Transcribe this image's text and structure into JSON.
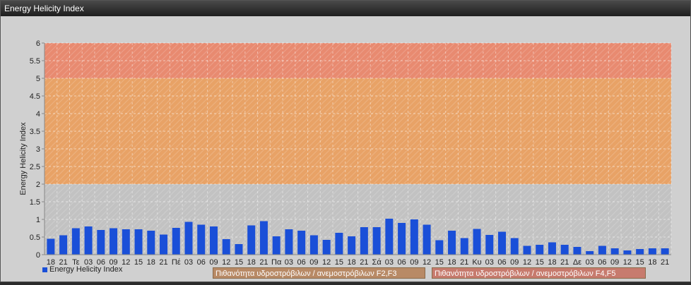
{
  "window": {
    "title": "Energy Helicity Index"
  },
  "legend": {
    "series_label": "Energy Helicity Index",
    "series_color": "#1a4fd8"
  },
  "zones": [
    {
      "label": "Πιθανότητα υδροστρόβιλων / ανεμοστρόβιλων F2,F3",
      "from": 2,
      "to": 5,
      "color": "#e8a266"
    },
    {
      "label": "Πιθανότητα υδροστρόβιλων / ανεμοστρόβιλων F4,F5",
      "from": 5,
      "to": 6,
      "color": "#e88a70"
    }
  ],
  "chart_data": {
    "type": "bar",
    "ylabel": "Energy Helicity Index",
    "ylim": [
      0,
      6
    ],
    "yticks": [
      "0",
      "0.5",
      "1",
      "1.5",
      "2",
      "2.5",
      "3",
      "3.5",
      "4",
      "4.5",
      "5",
      "5.5",
      "6"
    ],
    "grid": true,
    "categories": [
      "18",
      "21",
      "Τε",
      "03",
      "06",
      "09",
      "12",
      "15",
      "18",
      "21",
      "Πέ",
      "03",
      "06",
      "09",
      "12",
      "15",
      "18",
      "21",
      "Πα",
      "03",
      "06",
      "09",
      "12",
      "15",
      "18",
      "21",
      "Σά",
      "03",
      "06",
      "09",
      "12",
      "15",
      "18",
      "21",
      "Κυ",
      "03",
      "06",
      "09",
      "12",
      "15",
      "18",
      "21",
      "Δε",
      "03",
      "06",
      "09",
      "12",
      "15",
      "18",
      "21"
    ],
    "series": [
      {
        "name": "Energy Helicity Index",
        "values": [
          0.45,
          0.55,
          0.75,
          0.8,
          0.7,
          0.75,
          0.72,
          0.72,
          0.68,
          0.57,
          0.76,
          0.93,
          0.85,
          0.8,
          0.44,
          0.3,
          0.83,
          0.95,
          0.52,
          0.72,
          0.68,
          0.55,
          0.42,
          0.62,
          0.52,
          0.78,
          0.78,
          1.02,
          0.9,
          1.0,
          0.85,
          0.41,
          0.68,
          0.47,
          0.73,
          0.56,
          0.65,
          0.47,
          0.25,
          0.28,
          0.35,
          0.28,
          0.22,
          0.1,
          0.25,
          0.18,
          0.12,
          0.16,
          0.18,
          0.18
        ]
      }
    ]
  }
}
